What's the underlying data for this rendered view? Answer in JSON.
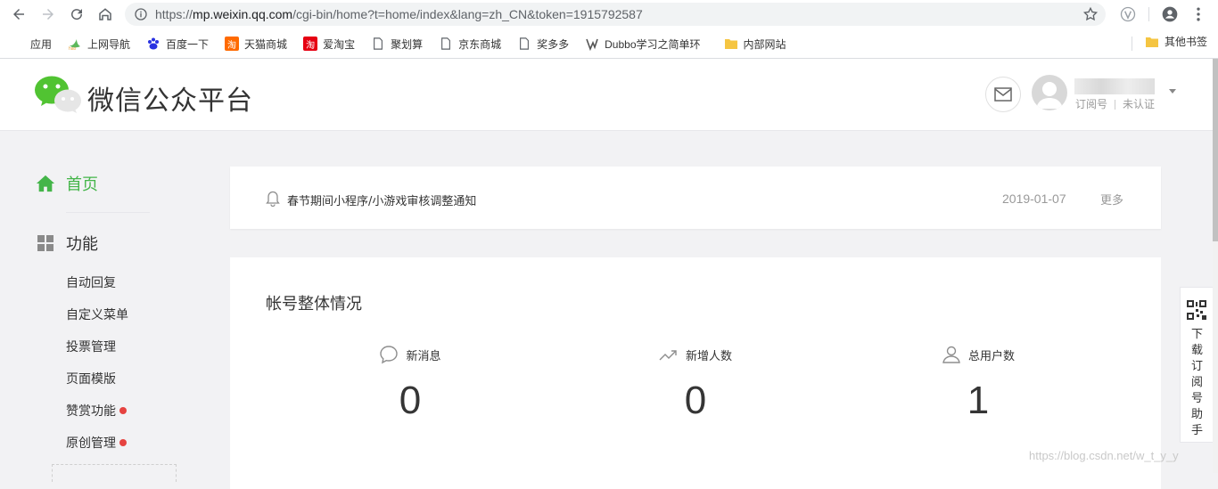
{
  "browser": {
    "url_scheme": "https://",
    "url_host": "mp.weixin.qq.com",
    "url_path": "/cgi-bin/home?t=home/index&lang=zh_CN&token=1915792587",
    "bookmarks": [
      {
        "label": "应用",
        "icon": "apps-grid-icon",
        "color": "#1a73e8"
      },
      {
        "label": "上网导航",
        "icon": "hao123-icon",
        "color": "#4caf50"
      },
      {
        "label": "百度一下",
        "icon": "baidu-paw-icon",
        "color": "#2932e1"
      },
      {
        "label": "天猫商城",
        "icon": "tmall-icon",
        "color": "#ff6a00"
      },
      {
        "label": "爱淘宝",
        "icon": "aitaobao-icon",
        "color": "#e60012"
      },
      {
        "label": "聚划算",
        "icon": "page-icon",
        "color": "#5f6368"
      },
      {
        "label": "京东商城",
        "icon": "page-icon",
        "color": "#5f6368"
      },
      {
        "label": "奖多多",
        "icon": "page-icon",
        "color": "#5f6368"
      },
      {
        "label": "Dubbo学习之简单环",
        "icon": "dubbo-icon",
        "color": "#5f6368"
      },
      {
        "label": "内部网站",
        "icon": "folder-icon",
        "color": "#f5c542"
      }
    ],
    "other_bookmarks": "其他书签"
  },
  "header": {
    "brand": "微信公众平台",
    "account_type": "订阅号",
    "verify_status": "未认证"
  },
  "sidebar": {
    "home": "首页",
    "function_group": "功能",
    "items": [
      {
        "label": "自动回复",
        "badge": false
      },
      {
        "label": "自定义菜单",
        "badge": false
      },
      {
        "label": "投票管理",
        "badge": false
      },
      {
        "label": "页面模版",
        "badge": false
      },
      {
        "label": "赞赏功能",
        "badge": true
      },
      {
        "label": "原创管理",
        "badge": true
      }
    ]
  },
  "notice": {
    "text": "春节期间小程序/小游戏审核调整通知",
    "date": "2019-01-07",
    "more": "更多"
  },
  "overview": {
    "title": "帐号整体情况",
    "stats": [
      {
        "label": "新消息",
        "value": "0",
        "icon": "chat-bubble-icon"
      },
      {
        "label": "新增人数",
        "value": "0",
        "icon": "trend-up-icon"
      },
      {
        "label": "总用户数",
        "value": "1",
        "icon": "user-icon"
      }
    ]
  },
  "floater": {
    "text": "下载订阅号助手"
  },
  "watermark": "https://blog.csdn.net/w_t_y_y",
  "colors": {
    "accent_green": "#44b549",
    "badge_red": "#e64340"
  }
}
